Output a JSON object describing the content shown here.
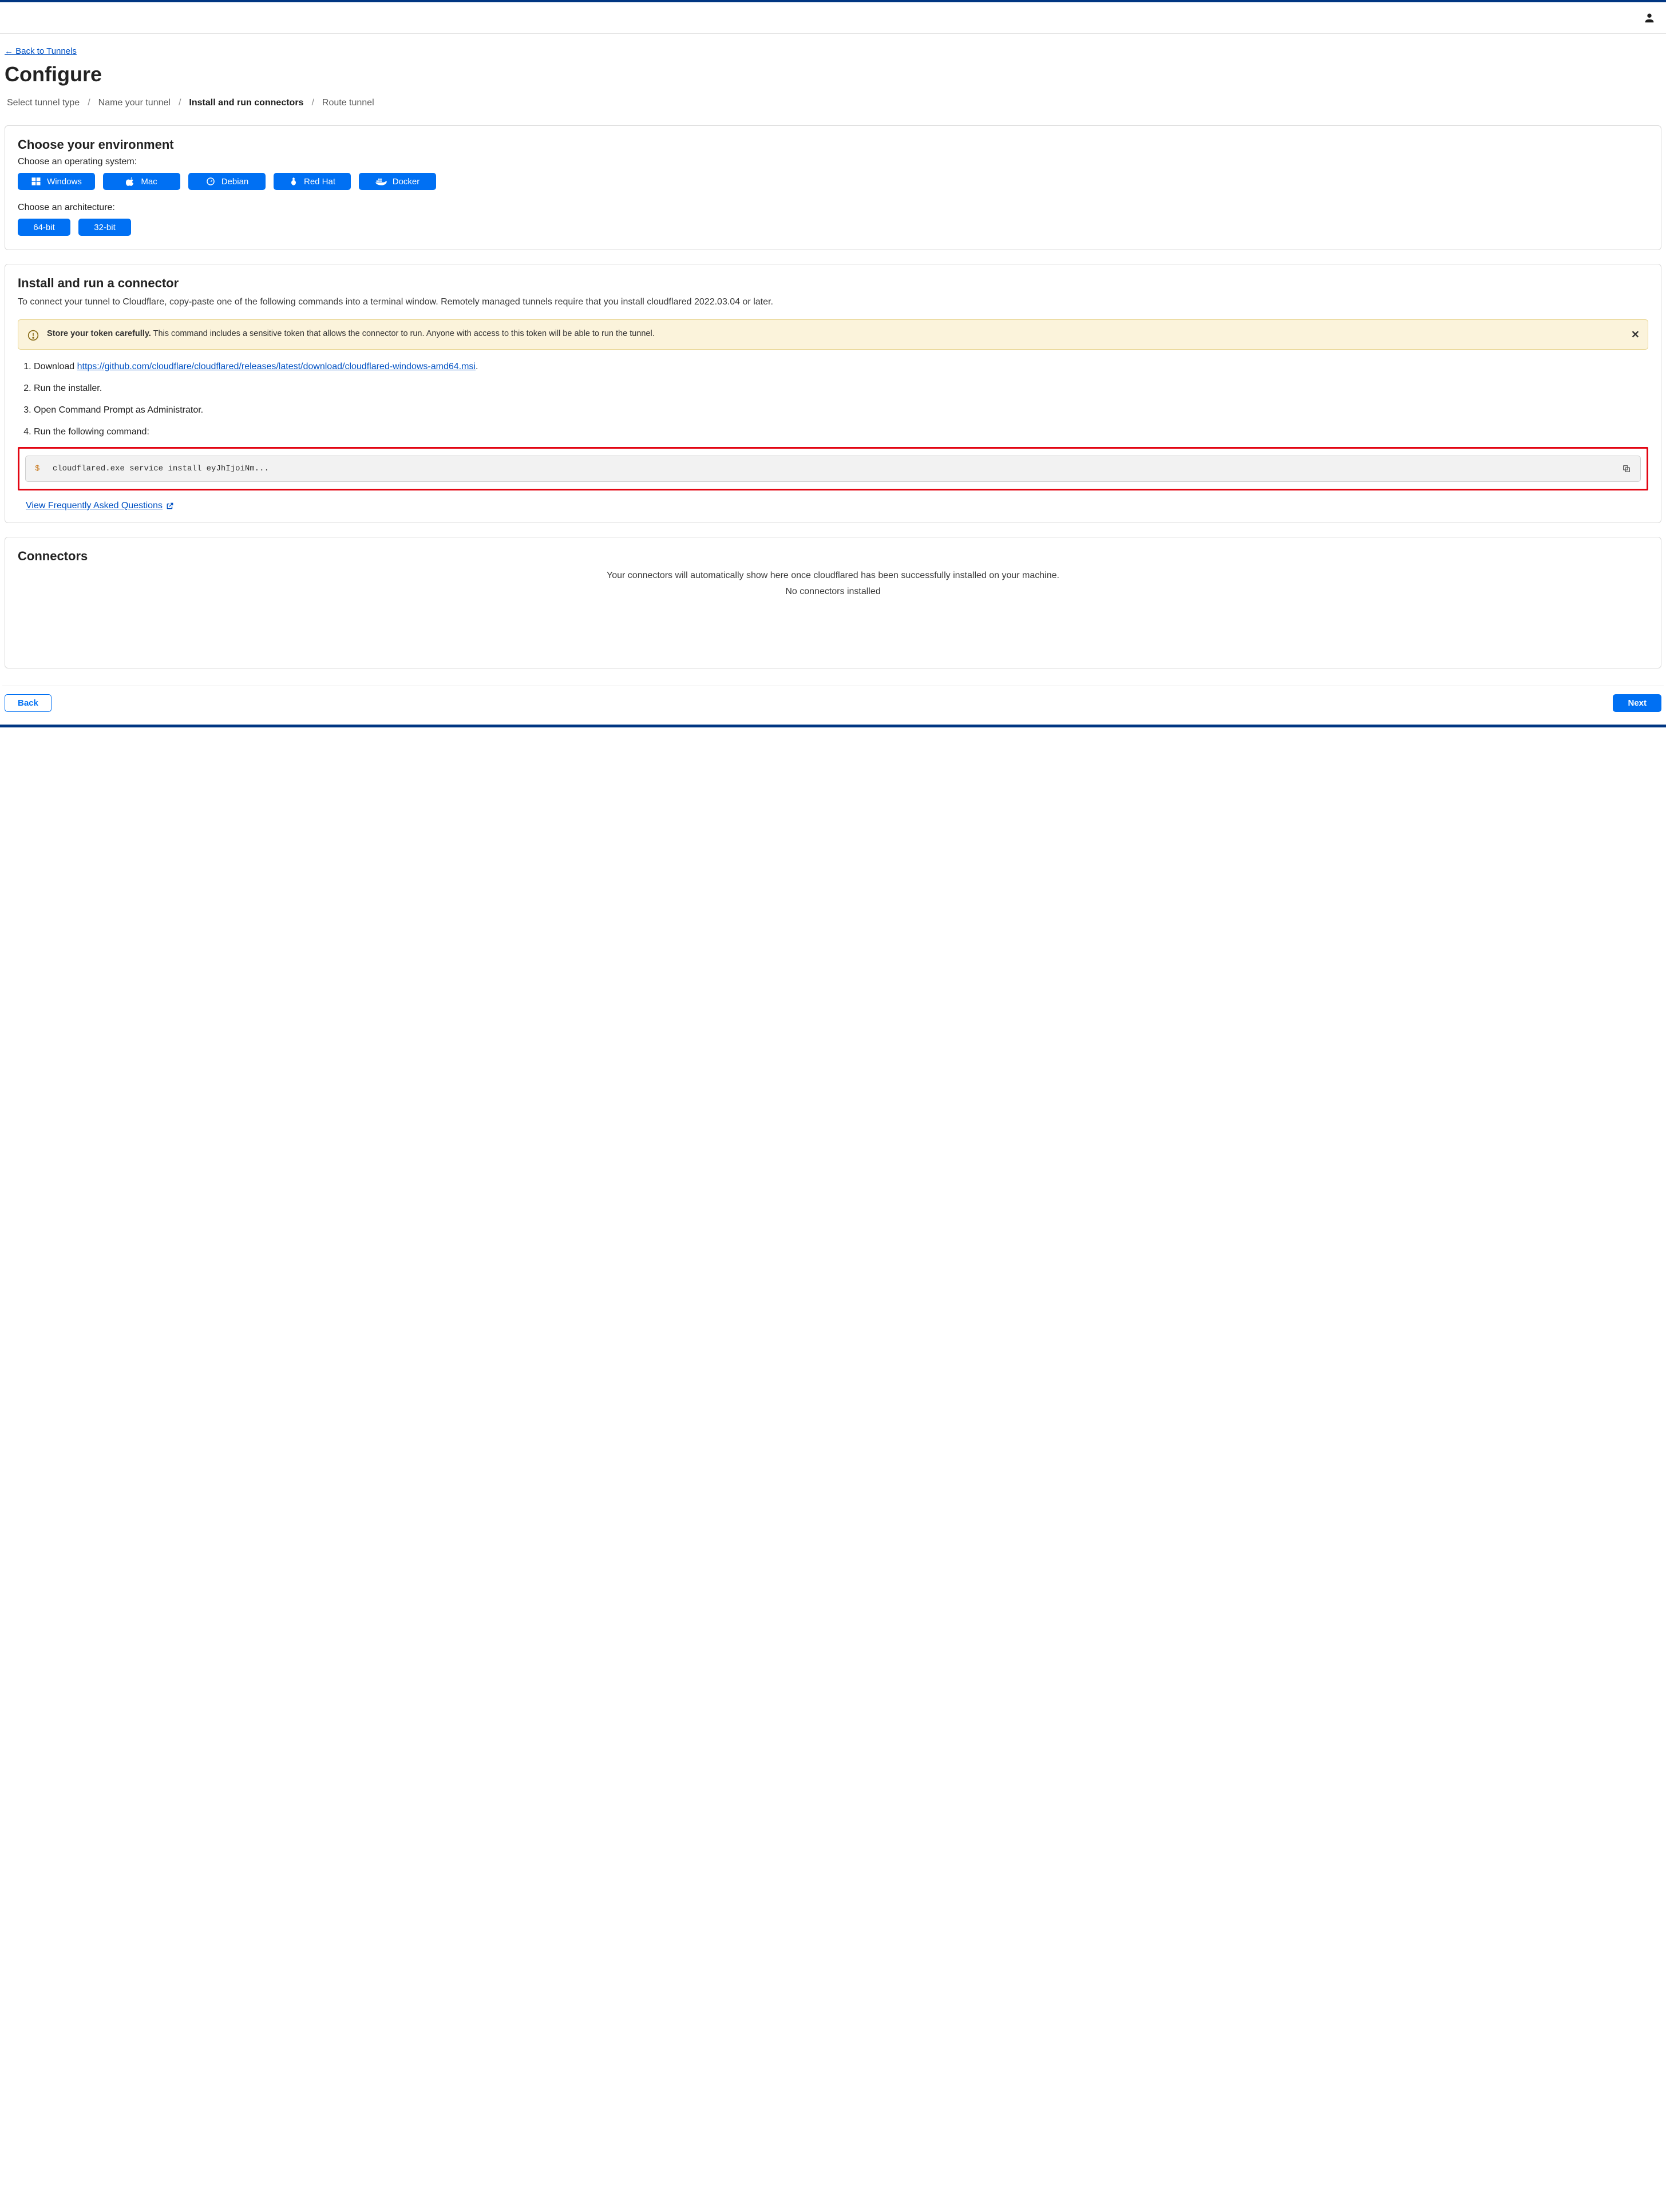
{
  "nav": {
    "back_label": "← Back to Tunnels",
    "page_title": "Configure",
    "breadcrumb": {
      "step1": "Select tunnel type",
      "step2": "Name your tunnel",
      "step3": "Install and run connectors",
      "step4": "Route tunnel"
    }
  },
  "env": {
    "heading": "Choose your environment",
    "os_label": "Choose an operating system:",
    "arch_label": "Choose an architecture:",
    "os": {
      "windows": "Windows",
      "mac": "Mac",
      "debian": "Debian",
      "redhat": "Red Hat",
      "docker": "Docker"
    },
    "arch": {
      "b64": "64-bit",
      "b32": "32-bit"
    }
  },
  "install": {
    "heading": "Install and run a connector",
    "description": "To connect your tunnel to Cloudflare, copy-paste one of the following commands into a terminal window. Remotely managed tunnels require that you install cloudflared 2022.03.04 or later.",
    "warning_bold": "Store your token carefully.",
    "warning_text": " This command includes a sensitive token that allows the connector to run. Anyone with access to this token will be able to run the tunnel.",
    "step1_prefix": "Download ",
    "step1_link": "https://github.com/cloudflare/cloudflared/releases/latest/download/cloudflared-windows-amd64.msi",
    "step1_suffix": ".",
    "step2": "Run the installer.",
    "step3": "Open Command Prompt as Administrator.",
    "step4": "Run the following command:",
    "command": "cloudflared.exe service install eyJhIjoiNm...",
    "faq_label": "View Frequently Asked Questions"
  },
  "connectors": {
    "heading": "Connectors",
    "message": "Your connectors will automatically show here once cloudflared has been successfully installed on your machine.",
    "empty": "No connectors installed"
  },
  "footer": {
    "back": "Back",
    "next": "Next"
  }
}
